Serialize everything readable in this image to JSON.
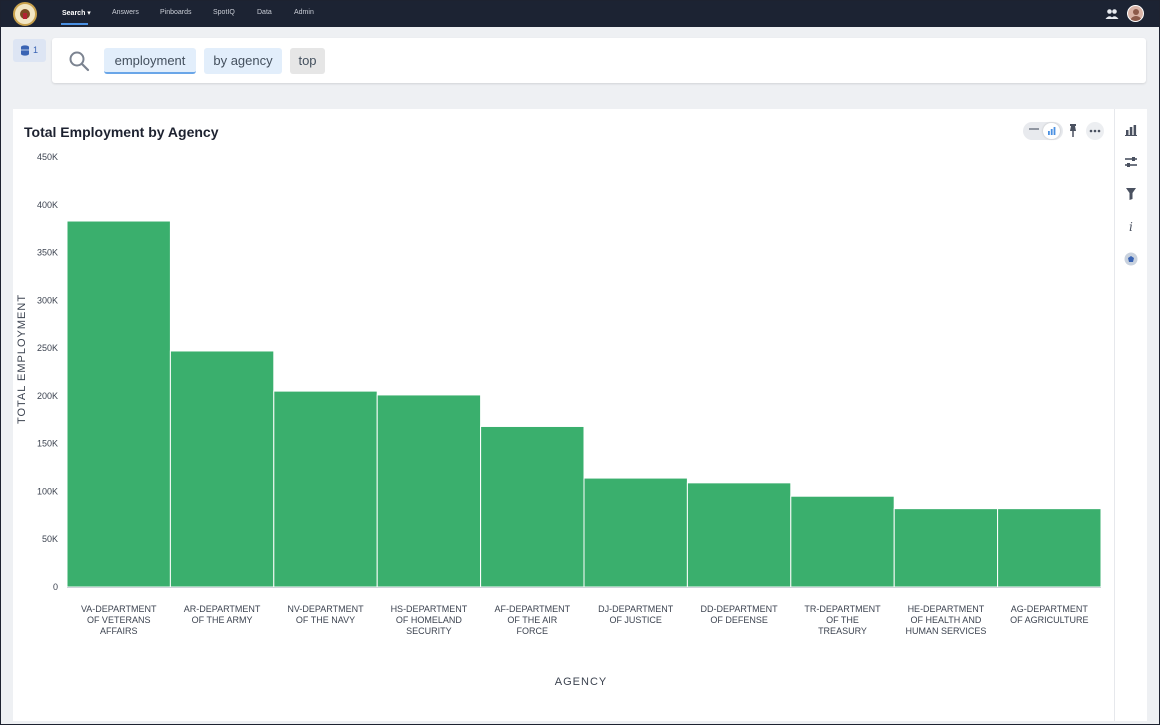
{
  "nav": {
    "items": [
      {
        "label": "Search ▾",
        "active": true
      },
      {
        "label": "Answers",
        "active": false
      },
      {
        "label": "Pinboards",
        "active": false
      },
      {
        "label": "SpotIQ",
        "active": false
      },
      {
        "label": "Data",
        "active": false
      },
      {
        "label": "Admin",
        "active": false
      }
    ]
  },
  "source": {
    "count": "1"
  },
  "search": {
    "tokens": [
      "employment",
      "by agency",
      "top"
    ]
  },
  "chart_title": "Total Employment by Agency",
  "chart_data": {
    "type": "bar",
    "title": "Total Employment by Agency",
    "xlabel": "AGENCY",
    "ylabel": "TOTAL EMPLOYMENT",
    "ylim": [
      0,
      450000
    ],
    "yticks": [
      "0",
      "50K",
      "100K",
      "150K",
      "200K",
      "250K",
      "300K",
      "350K",
      "400K",
      "450K"
    ],
    "categories": [
      "VA-DEPARTMENT OF VETERANS AFFAIRS",
      "AR-DEPARTMENT OF THE ARMY",
      "NV-DEPARTMENT OF THE NAVY",
      "HS-DEPARTMENT OF HOMELAND SECURITY",
      "AF-DEPARTMENT OF THE AIR FORCE",
      "DJ-DEPARTMENT OF JUSTICE",
      "DD-DEPARTMENT OF DEFENSE",
      "TR-DEPARTMENT OF THE TREASURY",
      "HE-DEPARTMENT OF HEALTH AND HUMAN SERVICES",
      "AG-DEPARTMENT OF AGRICULTURE"
    ],
    "category_lines": [
      [
        "VA-DEPARTMENT",
        "OF VETERANS",
        "AFFAIRS"
      ],
      [
        "AR-DEPARTMENT",
        "OF THE ARMY"
      ],
      [
        "NV-DEPARTMENT",
        "OF THE NAVY"
      ],
      [
        "HS-DEPARTMENT",
        "OF HOMELAND",
        "SECURITY"
      ],
      [
        "AF-DEPARTMENT",
        "OF THE AIR",
        "FORCE"
      ],
      [
        "DJ-DEPARTMENT",
        "OF JUSTICE"
      ],
      [
        "DD-DEPARTMENT",
        "OF DEFENSE"
      ],
      [
        "TR-DEPARTMENT",
        "OF THE",
        "TREASURY"
      ],
      [
        "HE-DEPARTMENT",
        "OF HEALTH AND",
        "HUMAN SERVICES"
      ],
      [
        "AG-DEPARTMENT",
        "OF AGRICULTURE"
      ]
    ],
    "values": [
      383000,
      247000,
      205000,
      201000,
      168000,
      114000,
      109000,
      95000,
      82000,
      82000
    ],
    "color": "#3aaf6d",
    "grid": false,
    "legend": "none"
  }
}
